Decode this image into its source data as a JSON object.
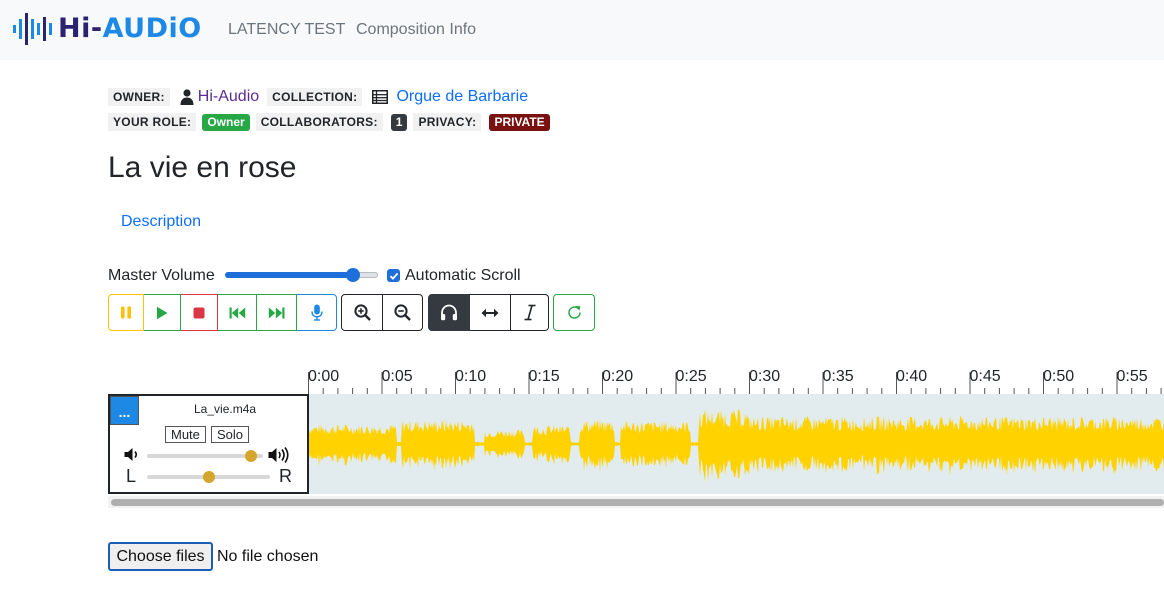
{
  "navbar": {
    "logo": {
      "hi": "Hi",
      "dash": "-",
      "audio": "AUDiO"
    },
    "links": [
      "LATENCY TEST",
      "Composition Info"
    ]
  },
  "meta": {
    "owner_label": "OWNER:",
    "owner_value": "Hi-Audio",
    "collection_label": "COLLECTION:",
    "collection_value": "Orgue de Barbarie",
    "role_label": "YOUR ROLE:",
    "role_badge": "Owner",
    "collaborators_label": "COLLABORATORS:",
    "collaborators_count": "1",
    "privacy_label": "PRIVACY:",
    "privacy_badge": "PRIVATE"
  },
  "composition": {
    "title": "La vie en rose",
    "tabs": [
      "Description"
    ]
  },
  "controls": {
    "master_volume_label": "Master Volume",
    "master_volume_level": 0.87,
    "automatic_scroll_label": "Automatic Scroll",
    "automatic_scroll_checked": true,
    "toolbar": [
      {
        "icon": "pause-icon",
        "color": "#ffc107"
      },
      {
        "icon": "play-icon",
        "color": "#28a745"
      },
      {
        "icon": "stop-icon",
        "color": "#dc3545"
      },
      {
        "icon": "skip-back-icon",
        "color": "#28a745"
      },
      {
        "icon": "skip-forward-icon",
        "color": "#28a745"
      },
      {
        "icon": "microphone-icon",
        "color": "#1e88e5"
      },
      {
        "icon": "zoom-in-icon",
        "color": "#212529"
      },
      {
        "icon": "zoom-out-icon",
        "color": "#212529"
      },
      {
        "icon": "headphones-icon",
        "color": "#343a40",
        "active": true
      },
      {
        "icon": "shift-icon",
        "color": "#212529"
      },
      {
        "icon": "cursor-icon",
        "color": "#212529"
      },
      {
        "icon": "refresh-icon",
        "color": "#28a745"
      }
    ]
  },
  "timeline": {
    "labels": [
      "0:00",
      "0:05",
      "0:10",
      "0:15",
      "0:20",
      "0:25",
      "0:30",
      "0:35",
      "0:40",
      "0:45",
      "0:50",
      "0:55"
    ]
  },
  "track": {
    "menu_label": "...",
    "name": "La_vie.m4a",
    "mute_label": "Mute",
    "solo_label": "Solo",
    "volume_level": 0.9,
    "pan_level": 0.5,
    "pan_left_label": "L",
    "pan_right_label": "R",
    "waveform_color": "#ffd200",
    "background_color": "#e2ecef"
  },
  "file_input": {
    "button_label": "Choose files",
    "status": "No file chosen"
  }
}
